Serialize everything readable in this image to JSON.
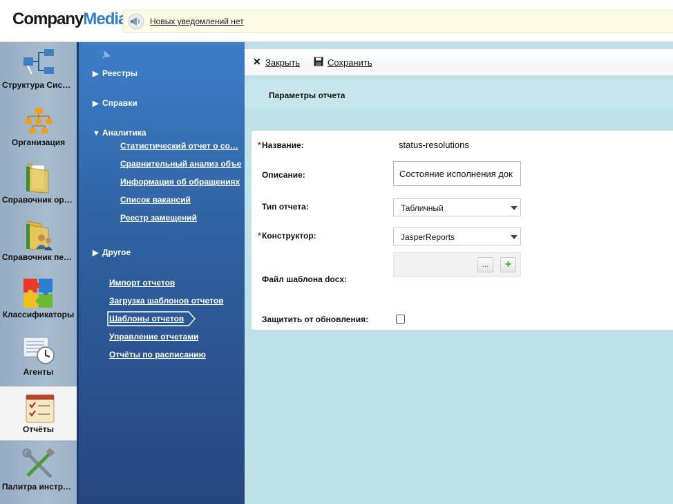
{
  "header": {
    "logo_part1": "Company",
    "logo_part2": "Media",
    "notification_text": "Новых уведомлений нет"
  },
  "iconbar": {
    "items": [
      {
        "label": "Структура Сист…",
        "icon": "structure-icon"
      },
      {
        "label": "Организация",
        "icon": "organization-icon"
      },
      {
        "label": "Справочник орг…",
        "icon": "folder-icon"
      },
      {
        "label": "Справочник пер…",
        "icon": "folder-people-icon"
      },
      {
        "label": "Классификаторы",
        "icon": "puzzle-icon"
      },
      {
        "label": "Агенты",
        "icon": "clock-document-icon"
      },
      {
        "label": "Отчёты",
        "icon": "checklist-icon",
        "active": true
      },
      {
        "label": "Палитра инстру…",
        "icon": "tools-icon"
      }
    ]
  },
  "nav": {
    "groups": {
      "registries": "Реестры",
      "references": "Справки",
      "analytics": "Аналитика",
      "other": "Другое"
    },
    "analytics_links": [
      "Статистический отчет о со…",
      "Сравнительный анализ объе",
      "Информация об обращениях",
      "Список вакансий",
      "Реестр замещений"
    ],
    "other_links": [
      "Импорт отчетов",
      "Загрузка шаблонов отчетов",
      "Шаблоны отчетов",
      "Управление отчетами",
      "Отчёты по расписанию"
    ],
    "selected_link": "Шаблоны отчетов"
  },
  "toolbar": {
    "close_label": "Закрыть",
    "save_label": "Сохранить"
  },
  "section": {
    "title": "Параметры отчета"
  },
  "form": {
    "name_label": "Название:",
    "name_value": "status-resolutions",
    "description_label": "Описание:",
    "description_value": "Состояние исполнения док",
    "type_label": "Тип отчета:",
    "type_value": "Табличный",
    "constructor_label": "Конструктор:",
    "constructor_value": "JasperReports",
    "docx_label": "Файл шаблона docx:",
    "browse_label": "...",
    "add_label": "+",
    "protect_label": "Защитить от обновления:",
    "protect_checked": false,
    "required_mark": "*"
  },
  "colors": {
    "accent": "#2f7fc2",
    "nav_bg": "#2e5f9e",
    "main_bg": "#bee1ea",
    "required": "#c0262c"
  }
}
